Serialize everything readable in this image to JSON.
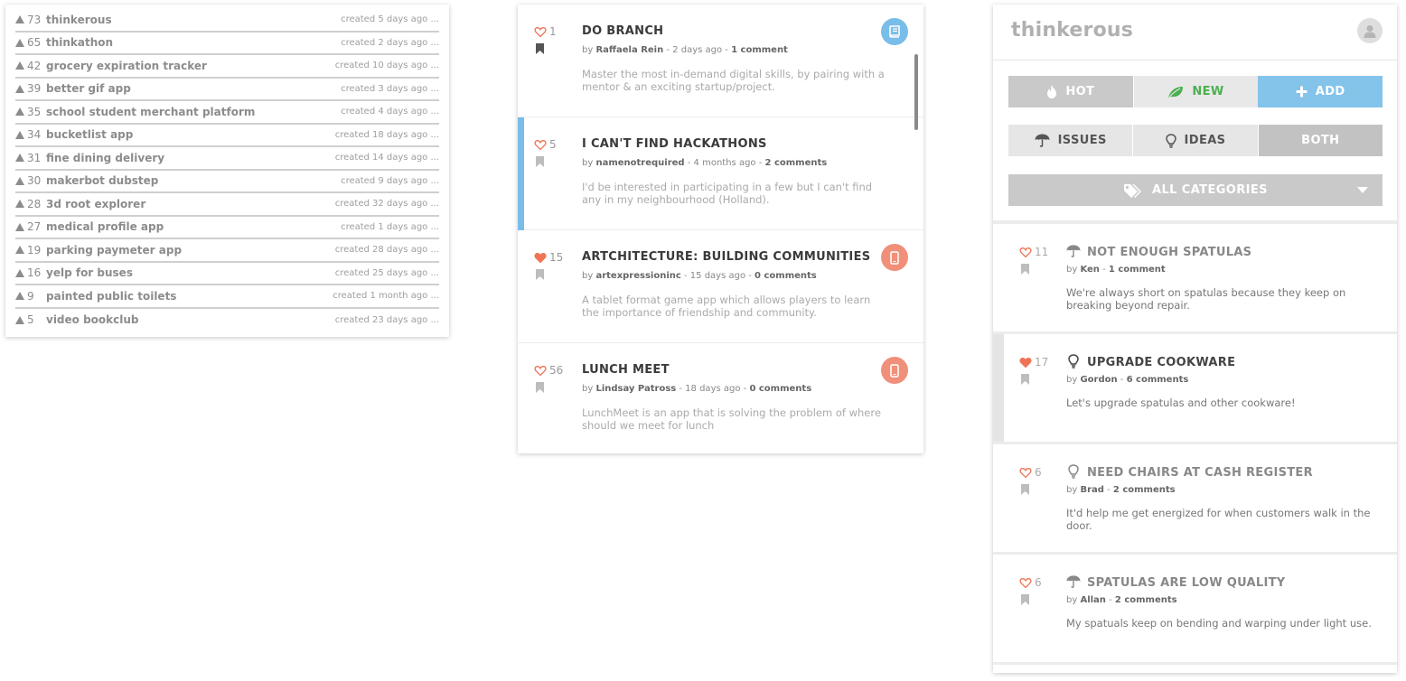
{
  "left_list": {
    "items": [
      {
        "votes": "73",
        "title": "thinkerous",
        "created": "created 5 days ago ..."
      },
      {
        "votes": "65",
        "title": "thinkathon",
        "created": "created 2 days ago ..."
      },
      {
        "votes": "42",
        "title": "grocery expiration tracker",
        "created": "created 10 days ago ..."
      },
      {
        "votes": "39",
        "title": "better gif app",
        "created": "created 3 days ago ..."
      },
      {
        "votes": "35",
        "title": "school student merchant platform",
        "created": "created 4 days ago ..."
      },
      {
        "votes": "34",
        "title": "bucketlist app",
        "created": "created 18 days ago ..."
      },
      {
        "votes": "31",
        "title": "fine dining delivery",
        "created": "created 14 days ago ..."
      },
      {
        "votes": "30",
        "title": "makerbot dubstep",
        "created": "created 9 days ago ..."
      },
      {
        "votes": "28",
        "title": "3d root explorer",
        "created": "created 32 days ago ..."
      },
      {
        "votes": "27",
        "title": "medical profile app",
        "created": "created 1 days ago ..."
      },
      {
        "votes": "19",
        "title": "parking paymeter app",
        "created": "created 28 days ago ..."
      },
      {
        "votes": "16",
        "title": "yelp for buses",
        "created": "created 25 days ago ..."
      },
      {
        "votes": "9",
        "title": "painted public toilets",
        "created": "created 1 month ago ..."
      },
      {
        "votes": "5",
        "title": "video bookclub",
        "created": "created 23 days ago ..."
      }
    ]
  },
  "middle_feed": {
    "posts": [
      {
        "votes": "1",
        "title": "DO BRANCH",
        "by": "by ",
        "author": "Raffaela Rein",
        "age": " - 2 days ago - ",
        "comments": "1 comment",
        "desc": "Master the most in-demand digital skills, by pairing with a mentor & an exciting startup/project.",
        "liked": false,
        "bookmarked": true,
        "badge": "book-icon"
      },
      {
        "votes": "5",
        "title": "I CAN'T FIND HACKATHONS",
        "by": "by ",
        "author": "namenotrequired",
        "age": " - 4 months ago - ",
        "comments": "2 comments",
        "desc": "I'd be interested in participating in a few but I can't find any in my neighbourhood (Holland).",
        "liked": false,
        "bookmarked": false,
        "badge": ""
      },
      {
        "votes": "15",
        "title": "ARTCHITECTURE: BUILDING COMMUNITIES",
        "by": "by ",
        "author": "artexpressioninc",
        "age": " - 15 days ago - ",
        "comments": "0 comments",
        "desc": "A tablet format game app which allows players to learn the importance of friendship and community.",
        "liked": true,
        "bookmarked": false,
        "badge": "mobile-icon"
      },
      {
        "votes": "56",
        "title": "LUNCH MEET",
        "by": "by ",
        "author": "Lindsay Patross",
        "age": " - 18 days ago - ",
        "comments": "0 comments",
        "desc": "LunchMeet is an app that is solving the problem of where should we meet for lunch",
        "liked": false,
        "bookmarked": false,
        "badge": "mobile-icon"
      }
    ]
  },
  "right_app": {
    "brand": "thinkerous",
    "sort_buttons": {
      "hot": "HOT",
      "new": "NEW",
      "add": "ADD"
    },
    "type_buttons": {
      "issues": "ISSUES",
      "ideas": "IDEAS",
      "both": "BOTH"
    },
    "category_select": "ALL CATEGORIES",
    "posts": [
      {
        "votes": "11",
        "type_icon": "umbrella-icon",
        "title": "NOT ENOUGH SPATULAS",
        "by": "by ",
        "author": "Ken",
        "sep": " - ",
        "comments": "1 comment",
        "desc": "We're always short on spatulas because they keep on breaking beyond repair.",
        "liked": false
      },
      {
        "votes": "17",
        "type_icon": "lightbulb-icon",
        "title": "UPGRADE COOKWARE",
        "by": "by ",
        "author": "Gordon",
        "sep": " - ",
        "comments": "6 comments",
        "desc": "Let's upgrade spatulas and other cookware!",
        "liked": true
      },
      {
        "votes": "6",
        "type_icon": "lightbulb-icon",
        "title": "NEED CHAIRS AT CASH REGISTER",
        "by": "by ",
        "author": "Brad",
        "sep": " - ",
        "comments": "2 comments",
        "desc": "It'd help me get energized for when customers walk in the door.",
        "liked": false
      },
      {
        "votes": "6",
        "type_icon": "umbrella-icon",
        "title": "SPATULAS ARE LOW QUALITY",
        "by": "by ",
        "author": "Allan",
        "sep": " - ",
        "comments": "2 comments",
        "desc": "My spatuals keep on bending and warping under light use.",
        "liked": false
      }
    ]
  },
  "colors": {
    "accent_blue": "#79bde9",
    "heart_orange": "#ef7456",
    "badge_orange": "#f0907a",
    "new_green": "#4caf50"
  }
}
